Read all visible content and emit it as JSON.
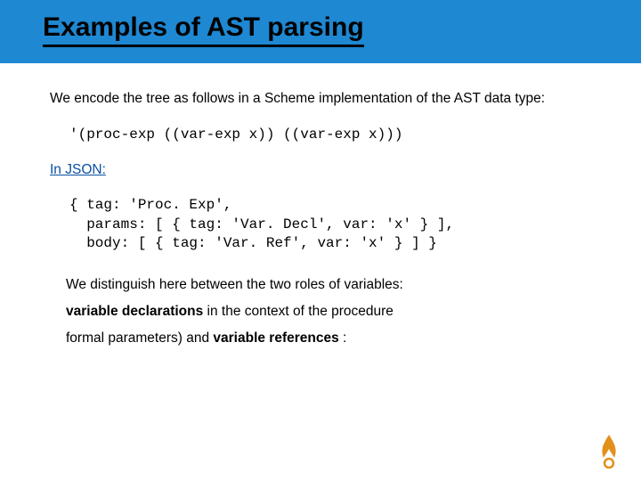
{
  "title": "Examples of AST parsing",
  "intro": "We encode the tree as follows in a Scheme implementation of the AST data type:",
  "scheme_code": "'(proc-exp ((var-exp x)) ((var-exp x)))",
  "in_json_label": "In JSON:",
  "json_code": "{ tag: 'Proc. Exp',\n  params: [ { tag: 'Var. Decl', var: 'x' } ],\n  body: [ { tag: 'Var. Ref', var: 'x' } ] }",
  "note1_pre": "We distinguish here between the two roles of variables:",
  "note2_bold": "variable declarations",
  "note2_post": " in the context of the procedure",
  "note3_pre": "formal parameters) and ",
  "note3_bold": "variable references",
  "note3_post": " :"
}
